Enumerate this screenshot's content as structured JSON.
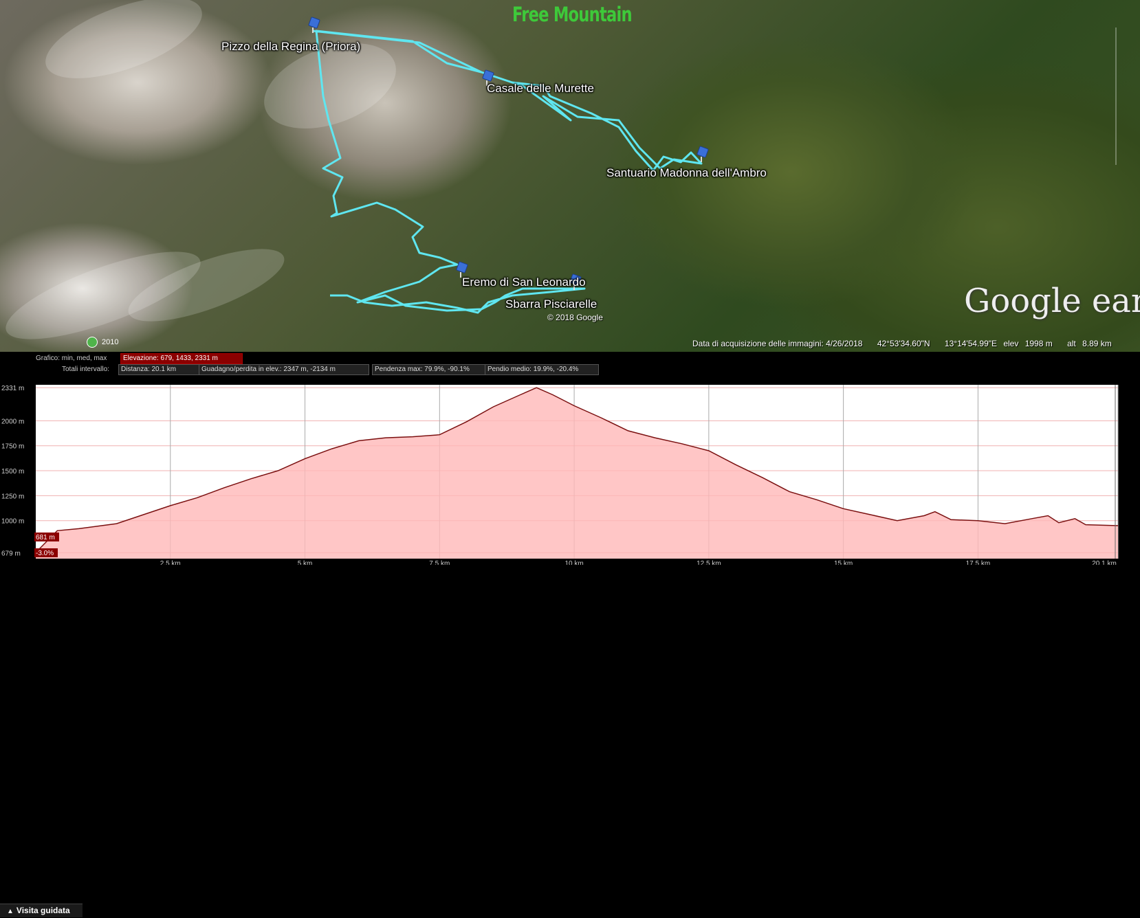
{
  "map": {
    "brand": "Free Mountain",
    "waypoints": [
      {
        "name": "Pizzo della Regina (Priora)"
      },
      {
        "name": "Casale delle Murette"
      },
      {
        "name": "Santuario Madonna dell'Ambro"
      },
      {
        "name": "Eremo di San Leonardo"
      },
      {
        "name": "Sbarra Pisciarelle"
      }
    ],
    "copyright": "© 2018 Google",
    "logo": "Google earth",
    "year_badge": "2010",
    "status": {
      "acquisition": "Data di acquisizione delle immagini: 4/26/2018",
      "lat": "42°53'34.60\"N",
      "lon": "13°14'54.99\"E",
      "elev_label": "elev",
      "elev": "1998 m",
      "alt_label": "alt",
      "alt": "8.89 km"
    },
    "track_color": "#5fe6f0",
    "pin_icon": "pushpin-icon"
  },
  "profile": {
    "graph_label": "Grafico: min, med, max",
    "elevation_box": "Elevazione: 679, 1433, 2331 m",
    "totals_label": "Totali intervallo:",
    "distance_box": "Distanza: 20.1 km",
    "gain_box": "Guadagno/perdita in elev.: 2347 m, -2134 m",
    "slope_max_box": "Pendenza max: 79.9%, -90.1%",
    "slope_avg_box": "Pendio medio: 19.9%, -20.4%",
    "cursor_elev": "681 m",
    "cursor_slope": "-3.0%",
    "fill_color": "#ffb8b8",
    "line_color": "#7a1010",
    "tour_button": "Visita guidata"
  },
  "chart_data": {
    "type": "area",
    "x_unit": "km",
    "y_unit": "m",
    "xlim": [
      0,
      20.1
    ],
    "ylim": [
      620,
      2360
    ],
    "y_ticks": [
      {
        "value": 679,
        "label": "679 m"
      },
      {
        "value": 1000,
        "label": "1000 m"
      },
      {
        "value": 1250,
        "label": "1250 m"
      },
      {
        "value": 1500,
        "label": "1500 m"
      },
      {
        "value": 1750,
        "label": "1750 m"
      },
      {
        "value": 2000,
        "label": "2000 m"
      },
      {
        "value": 2331,
        "label": "2331 m"
      }
    ],
    "x_ticks": [
      {
        "value": 2.5,
        "label": "2.5 km"
      },
      {
        "value": 5,
        "label": "5 km"
      },
      {
        "value": 7.5,
        "label": "7.5 km"
      },
      {
        "value": 10,
        "label": "10 km"
      },
      {
        "value": 12.5,
        "label": "12.5 km"
      },
      {
        "value": 15,
        "label": "15 km"
      },
      {
        "value": 17.5,
        "label": "17.5 km"
      },
      {
        "value": 20.1,
        "label": "20.1 km"
      }
    ],
    "x": [
      0,
      0.4,
      0.8,
      1.5,
      2.0,
      2.5,
      3.0,
      3.5,
      4.0,
      4.5,
      5.0,
      5.5,
      6.0,
      6.5,
      7.0,
      7.5,
      8.0,
      8.5,
      9.0,
      9.3,
      9.6,
      10.0,
      10.5,
      11.0,
      11.5,
      12.0,
      12.5,
      13.0,
      13.5,
      14.0,
      14.5,
      15.0,
      15.5,
      16.0,
      16.5,
      16.7,
      17.0,
      17.5,
      18.0,
      18.5,
      18.8,
      19.0,
      19.3,
      19.5,
      20.1
    ],
    "y": [
      681,
      900,
      920,
      970,
      1060,
      1150,
      1230,
      1330,
      1420,
      1500,
      1620,
      1720,
      1800,
      1830,
      1840,
      1860,
      1990,
      2140,
      2260,
      2331,
      2260,
      2150,
      2030,
      1900,
      1830,
      1770,
      1700,
      1560,
      1430,
      1290,
      1210,
      1120,
      1060,
      1000,
      1050,
      1090,
      1010,
      1000,
      970,
      1020,
      1050,
      980,
      1020,
      960,
      950
    ]
  }
}
